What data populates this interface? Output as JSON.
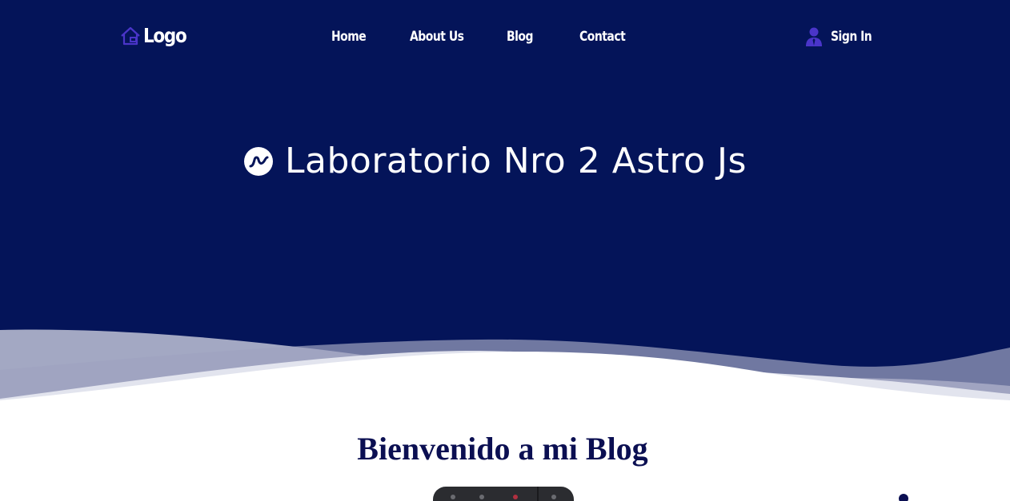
{
  "nav": {
    "logo_text": "Logo",
    "links": [
      {
        "label": "Home"
      },
      {
        "label": "About Us"
      },
      {
        "label": "Blog"
      },
      {
        "label": "Contact"
      }
    ],
    "signin_label": "Sign In"
  },
  "hero": {
    "title": "Laboratorio Nro 2 Astro Js"
  },
  "main": {
    "welcome_heading": "Bienvenido a mi Blog"
  },
  "colors": {
    "hero_background": "#041459",
    "accent_icon": "#4a35c9",
    "heading": "#0b0f52",
    "text_on_dark": "#ffffff"
  },
  "icons": {
    "logo": "house-icon",
    "signin": "user-icon",
    "title": "astro-wave-icon"
  }
}
